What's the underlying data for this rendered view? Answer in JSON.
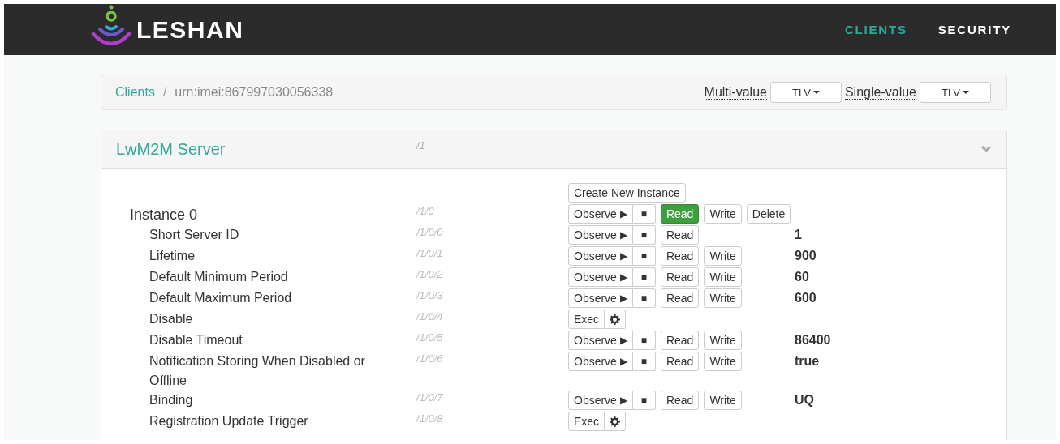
{
  "navbar": {
    "brand": "LESHAN",
    "links": [
      {
        "label": "CLIENTS",
        "selected": true
      },
      {
        "label": "SECURITY",
        "selected": false
      }
    ]
  },
  "breadcrumb": {
    "separator": "/",
    "items": [
      {
        "label": "Clients",
        "link": true
      },
      {
        "label": "urn:imei:867997030056338",
        "link": false
      }
    ]
  },
  "formats": [
    {
      "label": "Multi-value",
      "value": "TLV"
    },
    {
      "label": "Single-value",
      "value": "TLV"
    }
  ],
  "object": {
    "name": "LwM2M Server",
    "path": "/1",
    "expanded": true,
    "create_button": "Create New Instance",
    "instances": [
      {
        "name": "Instance 0",
        "path": "/1/0",
        "buttons": [
          {
            "kind": "observe",
            "label": "Observe",
            "icon": "▶"
          },
          {
            "kind": "stop",
            "label": "■"
          },
          {
            "kind": "plain",
            "label": "Read",
            "success": true
          },
          {
            "kind": "plain",
            "label": "Write",
            "success": false
          },
          {
            "kind": "plain",
            "label": "Delete",
            "success": false
          }
        ],
        "resources": [
          {
            "name": "Short Server ID",
            "path": "/1/0/0",
            "value": "1",
            "buttons": [
              {
                "kind": "observe",
                "label": "Observe",
                "icon": "▶"
              },
              {
                "kind": "stop",
                "label": "■"
              },
              {
                "kind": "plain",
                "label": "Read",
                "success": false
              }
            ]
          },
          {
            "name": "Lifetime",
            "path": "/1/0/1",
            "value": "900",
            "buttons": [
              {
                "kind": "observe",
                "label": "Observe",
                "icon": "▶"
              },
              {
                "kind": "stop",
                "label": "■"
              },
              {
                "kind": "plain",
                "label": "Read",
                "success": false
              },
              {
                "kind": "plain",
                "label": "Write",
                "success": false
              }
            ]
          },
          {
            "name": "Default Minimum Period",
            "path": "/1/0/2",
            "value": "60",
            "buttons": [
              {
                "kind": "observe",
                "label": "Observe",
                "icon": "▶"
              },
              {
                "kind": "stop",
                "label": "■"
              },
              {
                "kind": "plain",
                "label": "Read",
                "success": false
              },
              {
                "kind": "plain",
                "label": "Write",
                "success": false
              }
            ]
          },
          {
            "name": "Default Maximum Period",
            "path": "/1/0/3",
            "value": "600",
            "buttons": [
              {
                "kind": "observe",
                "label": "Observe",
                "icon": "▶"
              },
              {
                "kind": "stop",
                "label": "■"
              },
              {
                "kind": "plain",
                "label": "Read",
                "success": false
              },
              {
                "kind": "plain",
                "label": "Write",
                "success": false
              }
            ]
          },
          {
            "name": "Disable",
            "path": "/1/0/4",
            "buttons": [
              {
                "kind": "exec",
                "label": "Exec"
              },
              {
                "kind": "gear"
              }
            ]
          },
          {
            "name": "Disable Timeout",
            "path": "/1/0/5",
            "value": "86400",
            "buttons": [
              {
                "kind": "observe",
                "label": "Observe",
                "icon": "▶"
              },
              {
                "kind": "stop",
                "label": "■"
              },
              {
                "kind": "plain",
                "label": "Read",
                "success": false
              },
              {
                "kind": "plain",
                "label": "Write",
                "success": false
              }
            ]
          },
          {
            "name": "Notification Storing When Disabled or Offline",
            "path": "/1/0/6",
            "value": "true",
            "buttons": [
              {
                "kind": "observe",
                "label": "Observe",
                "icon": "▶"
              },
              {
                "kind": "stop",
                "label": "■"
              },
              {
                "kind": "plain",
                "label": "Read",
                "success": false
              },
              {
                "kind": "plain",
                "label": "Write",
                "success": false
              }
            ]
          },
          {
            "name": "Binding",
            "path": "/1/0/7",
            "value": "UQ",
            "buttons": [
              {
                "kind": "observe",
                "label": "Observe",
                "icon": "▶"
              },
              {
                "kind": "stop",
                "label": "■"
              },
              {
                "kind": "plain",
                "label": "Read",
                "success": false
              },
              {
                "kind": "plain",
                "label": "Write",
                "success": false
              }
            ]
          },
          {
            "name": "Registration Update Trigger",
            "path": "/1/0/8",
            "buttons": [
              {
                "kind": "exec",
                "label": "Exec"
              },
              {
                "kind": "gear"
              }
            ]
          }
        ]
      }
    ]
  }
}
